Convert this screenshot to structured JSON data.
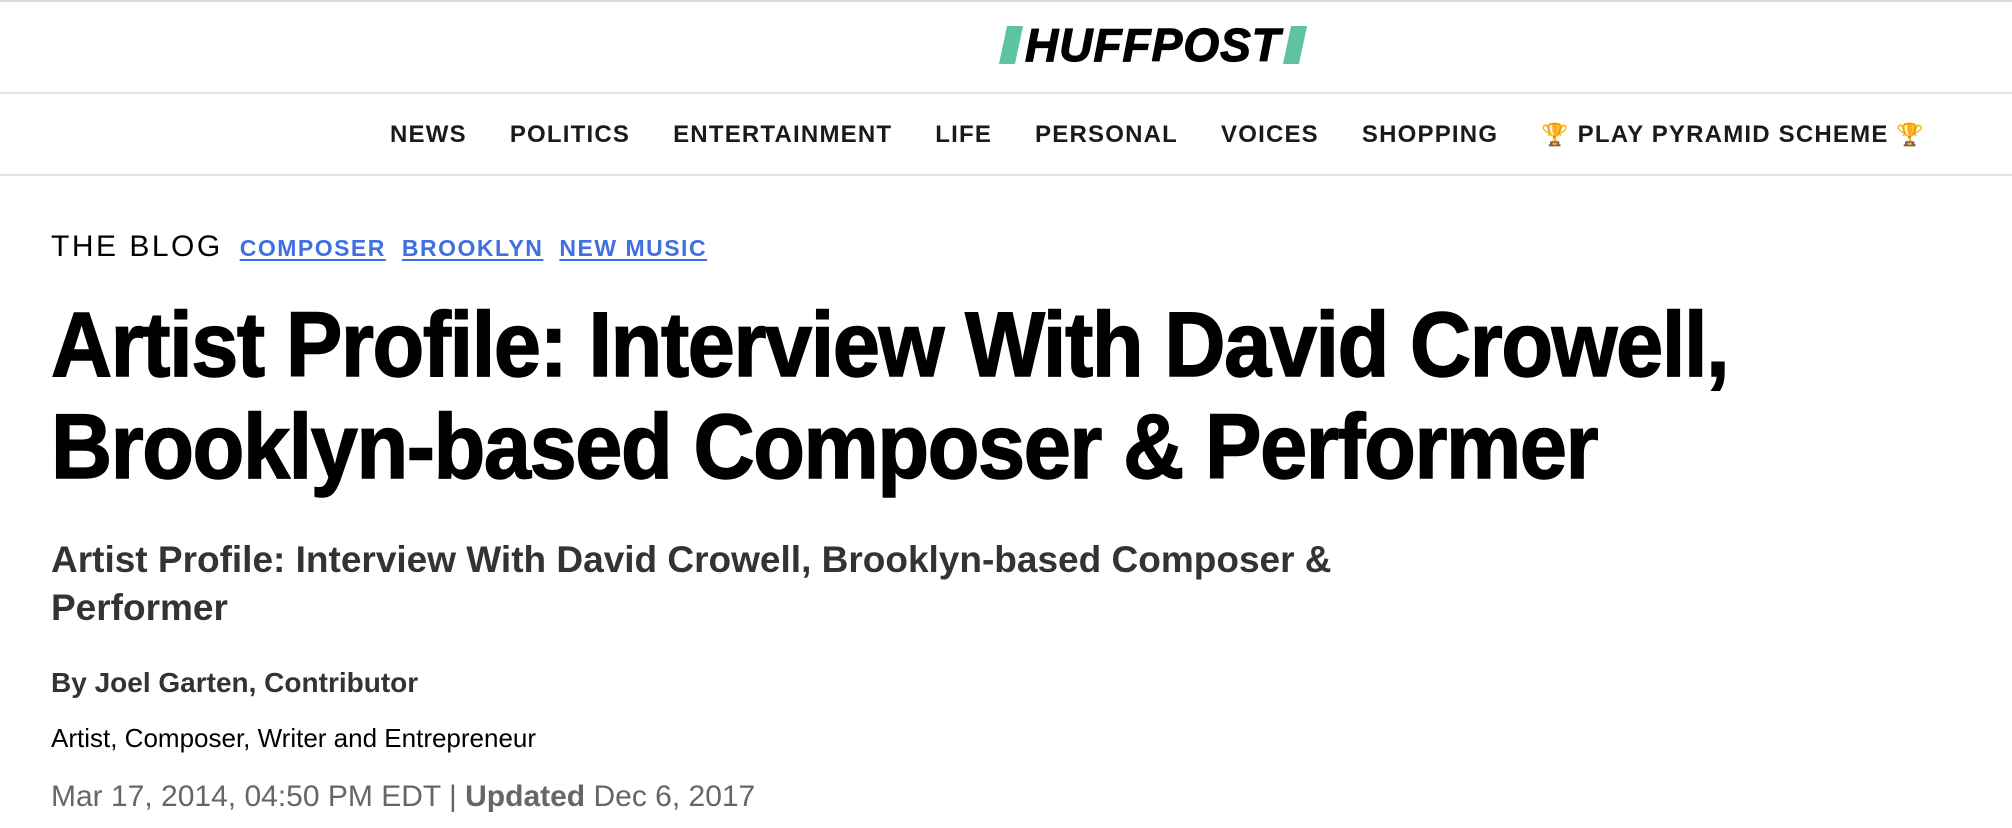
{
  "header": {
    "logo_text": "HUFFPOST",
    "logo_accent_color": "#5ec4a0"
  },
  "nav": {
    "items": [
      "NEWS",
      "POLITICS",
      "ENTERTAINMENT",
      "LIFE",
      "PERSONAL",
      "VOICES",
      "SHOPPING"
    ],
    "promo": {
      "icon_left": "🏆",
      "label": "PLAY PYRAMID SCHEME",
      "icon_right": "🏆"
    }
  },
  "article": {
    "section": "THE BLOG",
    "tags": [
      "COMPOSER",
      "BROOKLYN",
      "NEW MUSIC"
    ],
    "tag_color": "#3f6fe0",
    "headline": "Artist Profile: Interview With David Crowell, Brooklyn-based Composer & Performer",
    "subheadline": "Artist Profile: Interview With David Crowell, Brooklyn-based Composer & Performer",
    "byline": "By Joel Garten, Contributor",
    "author_bio": "Artist, Composer, Writer and Entrepreneur",
    "published": "Mar 17, 2014, 04:50 PM EDT",
    "separator": " | ",
    "updated_label": "Updated",
    "updated": "Dec 6, 2017"
  }
}
